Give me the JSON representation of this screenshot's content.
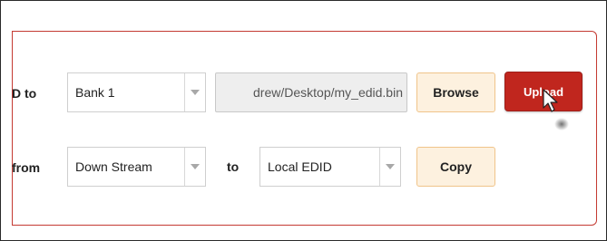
{
  "upload_row": {
    "label": "D to",
    "bank_select": {
      "selected": "Bank 1"
    },
    "file_path": "drew/Desktop/my_edid.bin",
    "browse_label": "Browse",
    "upload_label": "Upload"
  },
  "copy_row": {
    "label": "from",
    "source_select": {
      "selected": "Down Stream"
    },
    "to_label": "to",
    "target_select": {
      "selected": "Local EDID"
    },
    "copy_label": "Copy"
  },
  "colors": {
    "panel_border": "#c43a32",
    "upload_button": "#c0261e",
    "light_button": "#fdf1df",
    "light_button_border": "#f0c48a"
  },
  "icons": {
    "dropdown": "chevron-down-icon",
    "pointer": "hand-cursor-icon"
  }
}
